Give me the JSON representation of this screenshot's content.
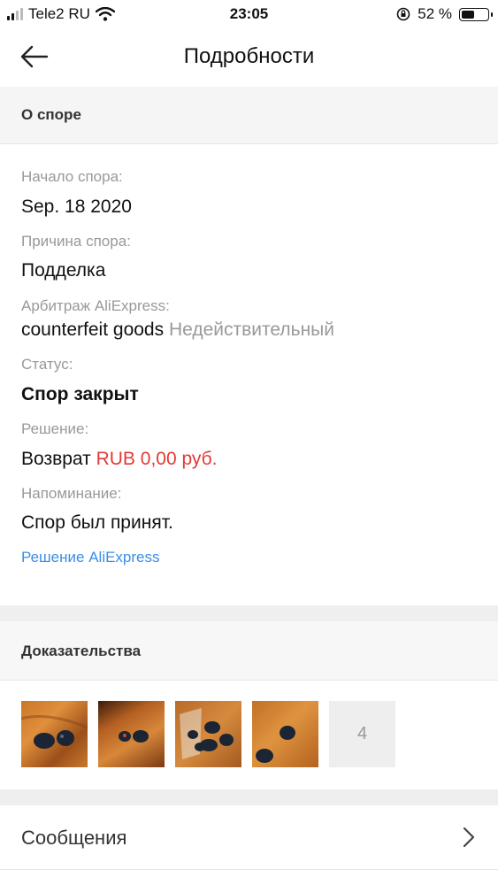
{
  "status_bar": {
    "carrier": "Tele2 RU",
    "time": "23:05",
    "battery_percent": "52 %",
    "battery_level": 0.52,
    "icons": [
      "signal-icon",
      "wifi-icon",
      "rotation-lock-icon",
      "battery-icon"
    ]
  },
  "nav": {
    "title": "Подробности",
    "back_icon": "back-arrow-icon"
  },
  "dispute": {
    "header": "О споре",
    "start_label": "Начало спора:",
    "start_value": "Sep. 18 2020",
    "reason_label": "Причина спора:",
    "reason_value": "Подделка",
    "arbitration_label": "Арбитраж AliExpress:",
    "arbitration_value": "counterfeit goods",
    "arbitration_status": "Недействительный",
    "status_label": "Статус:",
    "status_value": "Спор закрыт",
    "decision_label": "Решение:",
    "decision_value": "Возврат",
    "decision_amount": "RUB 0,00 руб.",
    "reminder_label": "Напоминание:",
    "reminder_value": "Спор был принят.",
    "decision_link": "Решение AliExpress"
  },
  "evidence": {
    "header": "Доказательства",
    "photos": [
      "photo-1",
      "photo-2",
      "photo-3",
      "photo-4"
    ],
    "more_count": "4"
  },
  "messages": {
    "label": "Сообщения",
    "icon": "chevron-right-icon"
  },
  "colors": {
    "accent_red": "#e53935",
    "link_blue": "#3a8ee6",
    "muted_text": "#999999",
    "section_bg": "#f5f5f5"
  }
}
